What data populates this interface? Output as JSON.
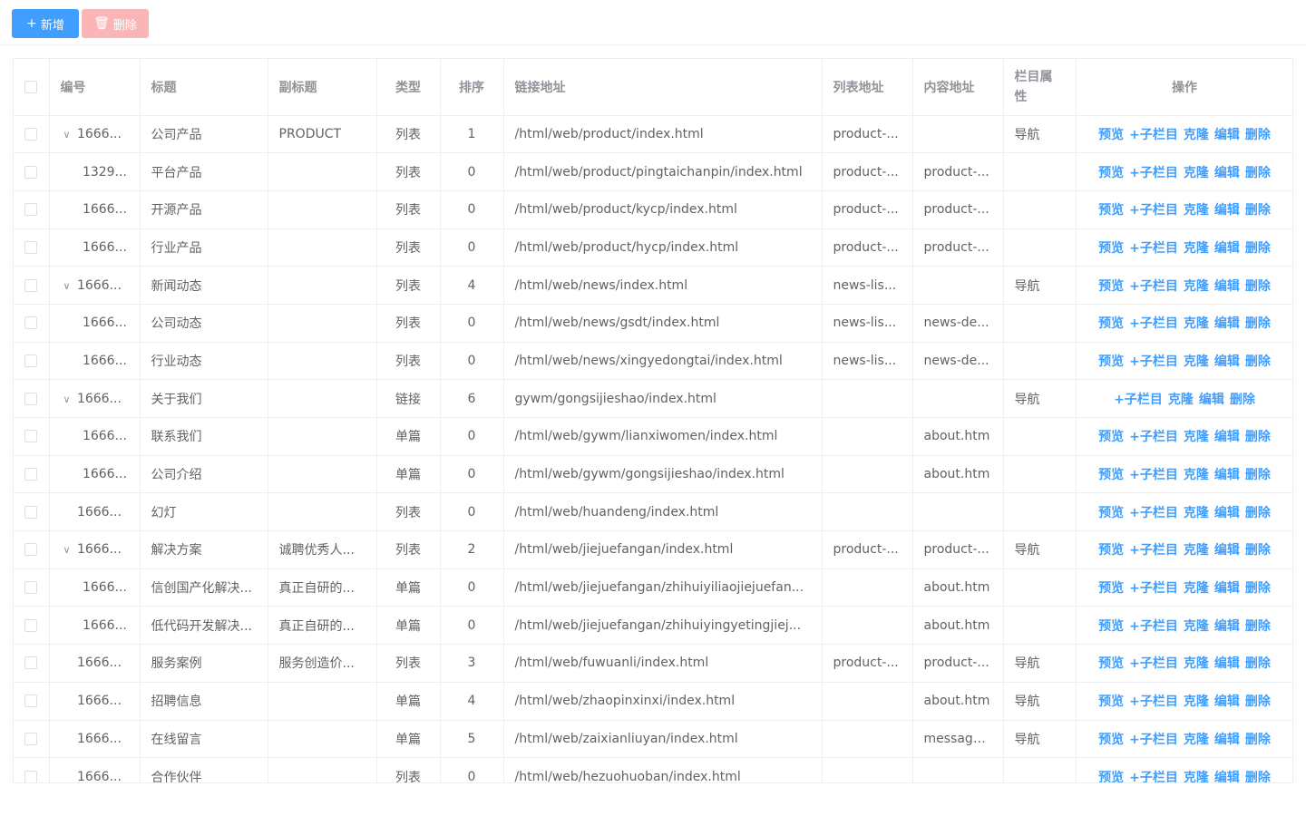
{
  "toolbar": {
    "add_label": "新增",
    "add_icon": "+",
    "delete_label": "删除",
    "delete_icon": "🗑"
  },
  "colors": {
    "primary": "#409eff",
    "danger_disabled": "#fab6b6",
    "header_text": "#909399",
    "border": "#ebeef5"
  },
  "table": {
    "columns": [
      "编号",
      "标题",
      "副标题",
      "类型",
      "排序",
      "链接地址",
      "列表地址",
      "内容地址",
      "栏目属性",
      "操作"
    ],
    "op_labels": {
      "preview": "预览",
      "add_child": "+子栏目",
      "clone": "克隆",
      "edit": "编辑",
      "delete": "删除"
    },
    "rows": [
      {
        "id": "1666...",
        "expandable": true,
        "child": false,
        "title": "公司产品",
        "subtitle": "PRODUCT",
        "type": "列表",
        "sort": "1",
        "link": "/html/web/product/index.html",
        "list": "product-...",
        "content": "",
        "attr": "导航",
        "preview": true
      },
      {
        "id": "1329...",
        "expandable": false,
        "child": true,
        "title": "平台产品",
        "subtitle": "",
        "type": "列表",
        "sort": "0",
        "link": "/html/web/product/pingtaichanpin/index.html",
        "list": "product-...",
        "content": "product-...",
        "attr": "",
        "preview": true
      },
      {
        "id": "1666...",
        "expandable": false,
        "child": true,
        "title": "开源产品",
        "subtitle": "",
        "type": "列表",
        "sort": "0",
        "link": "/html/web/product/kycp/index.html",
        "list": "product-...",
        "content": "product-...",
        "attr": "",
        "preview": true
      },
      {
        "id": "1666...",
        "expandable": false,
        "child": true,
        "title": "行业产品",
        "subtitle": "",
        "type": "列表",
        "sort": "0",
        "link": "/html/web/product/hycp/index.html",
        "list": "product-...",
        "content": "product-...",
        "attr": "",
        "preview": true
      },
      {
        "id": "1666...",
        "expandable": true,
        "child": false,
        "title": "新闻动态",
        "subtitle": "",
        "type": "列表",
        "sort": "4",
        "link": "/html/web/news/index.html",
        "list": "news-lis...",
        "content": "",
        "attr": "导航",
        "preview": true
      },
      {
        "id": "1666...",
        "expandable": false,
        "child": true,
        "title": "公司动态",
        "subtitle": "",
        "type": "列表",
        "sort": "0",
        "link": "/html/web/news/gsdt/index.html",
        "list": "news-lis...",
        "content": "news-de...",
        "attr": "",
        "preview": true
      },
      {
        "id": "1666...",
        "expandable": false,
        "child": true,
        "title": "行业动态",
        "subtitle": "",
        "type": "列表",
        "sort": "0",
        "link": "/html/web/news/xingyedongtai/index.html",
        "list": "news-lis...",
        "content": "news-de...",
        "attr": "",
        "preview": true
      },
      {
        "id": "1666...",
        "expandable": true,
        "child": false,
        "title": "关于我们",
        "subtitle": "",
        "type": "链接",
        "sort": "6",
        "link": "gywm/gongsijieshao/index.html",
        "list": "",
        "content": "",
        "attr": "导航",
        "preview": false
      },
      {
        "id": "1666...",
        "expandable": false,
        "child": true,
        "title": "联系我们",
        "subtitle": "",
        "type": "单篇",
        "sort": "0",
        "link": "/html/web/gywm/lianxiwomen/index.html",
        "list": "",
        "content": "about.htm",
        "attr": "",
        "preview": true
      },
      {
        "id": "1666...",
        "expandable": false,
        "child": true,
        "title": "公司介绍",
        "subtitle": "",
        "type": "单篇",
        "sort": "0",
        "link": "/html/web/gywm/gongsijieshao/index.html",
        "list": "",
        "content": "about.htm",
        "attr": "",
        "preview": true
      },
      {
        "id": "1666...",
        "expandable": false,
        "child": false,
        "title": "幻灯",
        "subtitle": "",
        "type": "列表",
        "sort": "0",
        "link": "/html/web/huandeng/index.html",
        "list": "",
        "content": "",
        "attr": "",
        "preview": true
      },
      {
        "id": "1666...",
        "expandable": true,
        "child": false,
        "title": "解决方案",
        "subtitle": "诚聘优秀人...",
        "type": "列表",
        "sort": "2",
        "link": "/html/web/jiejuefangan/index.html",
        "list": "product-...",
        "content": "product-...",
        "attr": "导航",
        "preview": true
      },
      {
        "id": "1666...",
        "expandable": false,
        "child": true,
        "title": "信创国产化解决...",
        "subtitle": "真正自研的...",
        "type": "单篇",
        "sort": "0",
        "link": "/html/web/jiejuefangan/zhihuiyiliaojiejuefan...",
        "list": "",
        "content": "about.htm",
        "attr": "",
        "preview": true
      },
      {
        "id": "1666...",
        "expandable": false,
        "child": true,
        "title": "低代码开发解决...",
        "subtitle": "真正自研的...",
        "type": "单篇",
        "sort": "0",
        "link": "/html/web/jiejuefangan/zhihuiyingyetingjiej...",
        "list": "",
        "content": "about.htm",
        "attr": "",
        "preview": true
      },
      {
        "id": "1666...",
        "expandable": false,
        "child": false,
        "title": "服务案例",
        "subtitle": "服务创造价...",
        "type": "列表",
        "sort": "3",
        "link": "/html/web/fuwuanli/index.html",
        "list": "product-...",
        "content": "product-...",
        "attr": "导航",
        "preview": true
      },
      {
        "id": "1666...",
        "expandable": false,
        "child": false,
        "title": "招聘信息",
        "subtitle": "",
        "type": "单篇",
        "sort": "4",
        "link": "/html/web/zhaopinxinxi/index.html",
        "list": "",
        "content": "about.htm",
        "attr": "导航",
        "preview": true
      },
      {
        "id": "1666...",
        "expandable": false,
        "child": false,
        "title": "在线留言",
        "subtitle": "",
        "type": "单篇",
        "sort": "5",
        "link": "/html/web/zaixianliuyan/index.html",
        "list": "",
        "content": "message...",
        "attr": "导航",
        "preview": true
      },
      {
        "id": "1666...",
        "expandable": false,
        "child": false,
        "title": "合作伙伴",
        "subtitle": "",
        "type": "列表",
        "sort": "0",
        "link": "/html/web/hezuohuoban/index.html",
        "list": "",
        "content": "",
        "attr": "",
        "preview": true
      }
    ]
  }
}
